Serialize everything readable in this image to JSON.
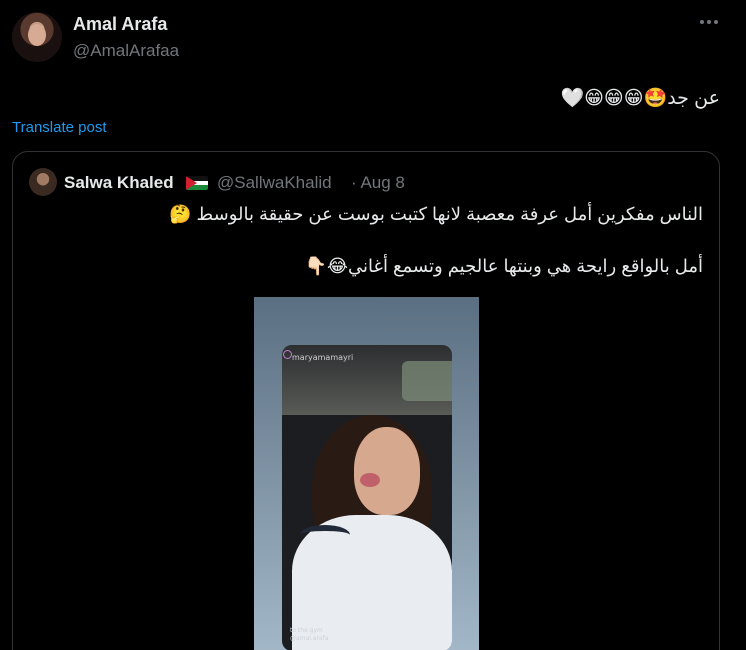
{
  "post": {
    "author_name": "Amal Arafa",
    "author_handle": "@AmalArafaa",
    "text": "عن جد🤩😁😁😁🤍",
    "translate_label": "Translate post",
    "more_icon": "more-horizontal-icon"
  },
  "quote": {
    "author_name": "Salwa Khaled",
    "flag": "🇯🇴",
    "author_handle": "@SallwaKhalid",
    "date": "· Aug 8",
    "line1": "الناس مفكرين أمل عرفة معصبة لانها كتبت بوست عن حقيقة بالوسط 🤔",
    "line2": "أمل بالواقع رايحة هي وبنتها عالجيم وتسمع أغاني😂👇🏻",
    "media": {
      "story_username": "maryamamayri",
      "caption_line1": "to the gym",
      "caption_line2": "@amal.arafa"
    }
  }
}
